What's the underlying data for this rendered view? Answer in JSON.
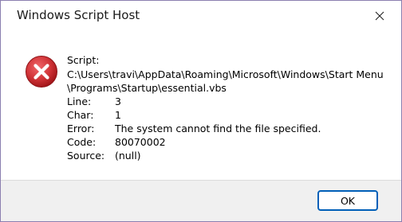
{
  "window": {
    "title": "Windows Script Host"
  },
  "message": {
    "script_label": "Script:",
    "script_path": "C:\\Users\\travi\\AppData\\Roaming\\Microsoft\\Windows\\Start Menu\\Programs\\Startup\\essential.vbs",
    "fields": [
      {
        "key": "Line:",
        "value": "3"
      },
      {
        "key": "Char:",
        "value": "1"
      },
      {
        "key": "Error:",
        "value": "The system cannot find the file specified."
      },
      {
        "key": "Code:",
        "value": "80070002"
      },
      {
        "key": "Source:",
        "value": "(null)"
      }
    ]
  },
  "buttons": {
    "ok_label": "OK"
  },
  "icons": {
    "status": "error-icon",
    "close": "close-icon"
  },
  "colors": {
    "error_red": "#d13438",
    "accent": "#005fb8"
  }
}
